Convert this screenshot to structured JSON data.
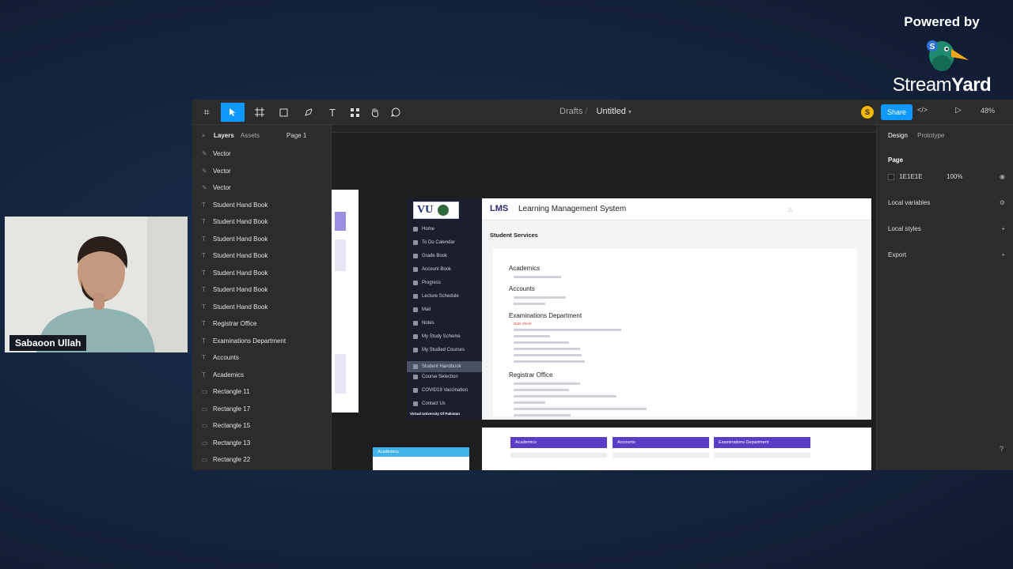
{
  "powered": {
    "label": "Powered by",
    "brand_a": "Stream",
    "brand_b": "Yard",
    "badge": "S"
  },
  "webcam": {
    "name": "Sabaoon Ullah"
  },
  "toolbar": {
    "figma_glyph": "⌗",
    "text_tool": "T",
    "breadcrumb_drafts": "Drafts",
    "title": "Untitled",
    "avatar": "S",
    "share": "Share",
    "code": "</>",
    "zoom": "48%"
  },
  "layers_panel": {
    "tab_layers": "Layers",
    "tab_assets": "Assets",
    "page": "Page 1",
    "items": [
      {
        "label": "Vector",
        "icon": "✎"
      },
      {
        "label": "Vector",
        "icon": "✎"
      },
      {
        "label": "Vector",
        "icon": "✎"
      },
      {
        "label": "Student Hand Book",
        "icon": "T"
      },
      {
        "label": "Student Hand Book",
        "icon": "T"
      },
      {
        "label": "Student Hand Book",
        "icon": "T"
      },
      {
        "label": "Student Hand Book",
        "icon": "T"
      },
      {
        "label": "Student Hand Book",
        "icon": "T"
      },
      {
        "label": "Student Hand Book",
        "icon": "T"
      },
      {
        "label": "Student Hand Book",
        "icon": "T"
      },
      {
        "label": "Registrar Office",
        "icon": "T"
      },
      {
        "label": "Examinations Department",
        "icon": "T"
      },
      {
        "label": "Accounts",
        "icon": "T"
      },
      {
        "label": "Academics",
        "icon": "T"
      },
      {
        "label": "Rectangle 11",
        "icon": "▭"
      },
      {
        "label": "Rectangle 17",
        "icon": "▭"
      },
      {
        "label": "Rectangle 15",
        "icon": "▭"
      },
      {
        "label": "Rectangle 13",
        "icon": "▭"
      },
      {
        "label": "Rectangle 22",
        "icon": "▭"
      }
    ]
  },
  "design_panel": {
    "tab_design": "Design",
    "tab_prototype": "Prototype",
    "page_heading": "Page",
    "page_color": "1E1E1E",
    "page_opacity": "100%",
    "local_variables": "Local variables",
    "local_styles": "Local styles",
    "export": "Export"
  },
  "lms": {
    "logo_text": "VU",
    "lms_logo": "LMS",
    "title": "Learning Management System",
    "subtitle": "Student Services",
    "sidebar": [
      "Home",
      "To Do Calendar",
      "Grade Book",
      "Account Book",
      "Progress",
      "Lecture Schedule",
      "Mail",
      "Notes",
      "My Study Scheme",
      "My Studied Courses",
      "Student Handbook",
      "Course Selection",
      "COVID19 Vaccination",
      "Contact Us"
    ],
    "sidebar_footer": "Virtual University Of Pakistan",
    "sections": {
      "academics": "Academics",
      "accounts": "Accounts",
      "exams": "Examinations Department",
      "registrar": "Registrar Office"
    },
    "exam_link_red": "Date Sheet",
    "bottom_tabs": [
      "Academics",
      "Accounts",
      "Examinations Department"
    ],
    "academics_chip": "Academics"
  },
  "colors": {
    "figma_blue": "#0d99ff",
    "lms_purple": "#5b3cc4"
  }
}
